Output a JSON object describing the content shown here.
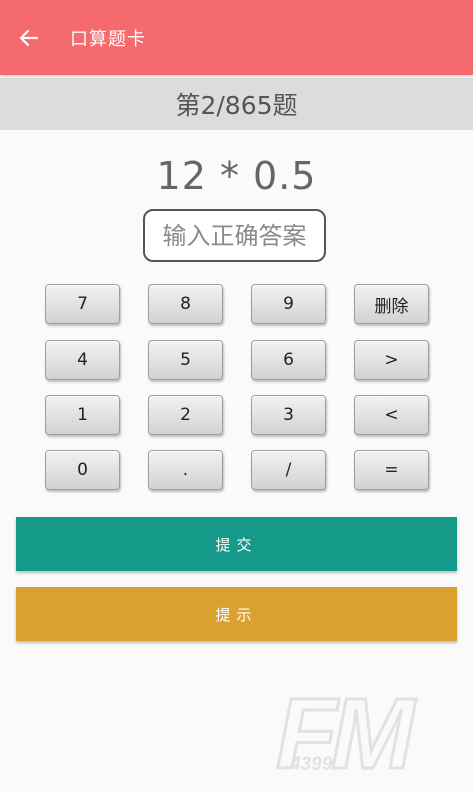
{
  "app_bar": {
    "title": "口算题卡",
    "back_icon": "arrow-left-icon",
    "color": "#f56a6d"
  },
  "progress": {
    "label": "第2/865题"
  },
  "question": {
    "expression": "12 * 0.5"
  },
  "answer": {
    "placeholder": "输入正确答案",
    "value": ""
  },
  "keypad": {
    "rows": [
      [
        "7",
        "8",
        "9",
        "删除"
      ],
      [
        "4",
        "5",
        "6",
        ">"
      ],
      [
        "1",
        "2",
        "3",
        "<"
      ],
      [
        "0",
        ".",
        "/",
        "="
      ]
    ]
  },
  "actions": {
    "submit_label": "提交",
    "submit_color": "#159a8a",
    "hint_label": "提示",
    "hint_color": "#daa130"
  },
  "watermark": {
    "brand": "FM",
    "sub": "4399"
  }
}
